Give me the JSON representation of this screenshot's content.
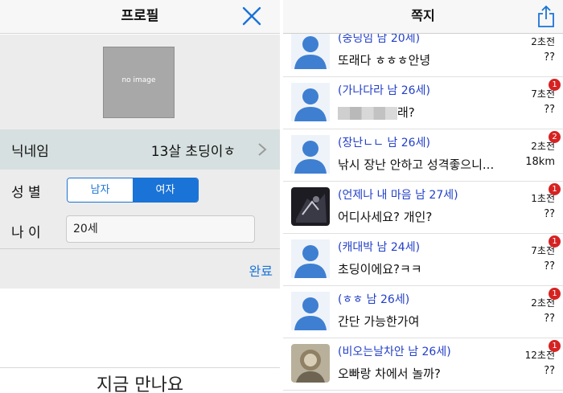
{
  "profile": {
    "title": "프로필",
    "photo_placeholder": "no image",
    "nickname_label": "닉네임",
    "nickname_value": "13살 초딩이ㅎ",
    "gender_label": "성 별",
    "gender_options": [
      "남자",
      "여자"
    ],
    "gender_selected": "여자",
    "age_label": "나 이",
    "age_value": "20세",
    "done_label": "완료",
    "footer_text": "지금 만나요"
  },
  "messages": {
    "title": "쪽지",
    "items": [
      {
        "sender": "(중딩임 남 20세)",
        "text": "또래다 ㅎㅎㅎ안녕",
        "time": "2초전",
        "distance": "??",
        "badge": "",
        "avatar": "default-user-icon"
      },
      {
        "sender": "(가나다라 남 26세)",
        "text": "래?",
        "time": "7초전",
        "distance": "??",
        "badge": "1",
        "avatar": "default-user-icon"
      },
      {
        "sender": "(장난ㄴㄴ 남 26세)",
        "text": "낚시 장난 안하고 성격좋으니...",
        "time": "2초전",
        "distance": "18km",
        "badge": "2",
        "avatar": "default-user-icon"
      },
      {
        "sender": "(언제나 내 마음 남 27세)",
        "text": "어디사세요? 개인?",
        "time": "1초전",
        "distance": "??",
        "badge": "1",
        "avatar": "dark-photo"
      },
      {
        "sender": "(캐대박 남 24세)",
        "text": "초딩이에요?ㅋㅋ",
        "time": "7초전",
        "distance": "??",
        "badge": "1",
        "avatar": "default-user-icon"
      },
      {
        "sender": "(ㅎㅎ 남 26세)",
        "text": "간단 가능한가여",
        "time": "2초전",
        "distance": "??",
        "badge": "1",
        "avatar": "default-user-icon"
      },
      {
        "sender": "(비오는날차안 남 26세)",
        "text": "오빠랑 차에서 놀까?",
        "time": "12초전",
        "distance": "??",
        "badge": "1",
        "avatar": "photo"
      }
    ]
  },
  "colors": {
    "accent": "#1a73d6",
    "sender": "#2340c8",
    "badge": "#d62222",
    "avatar": "#3f7fd1"
  }
}
